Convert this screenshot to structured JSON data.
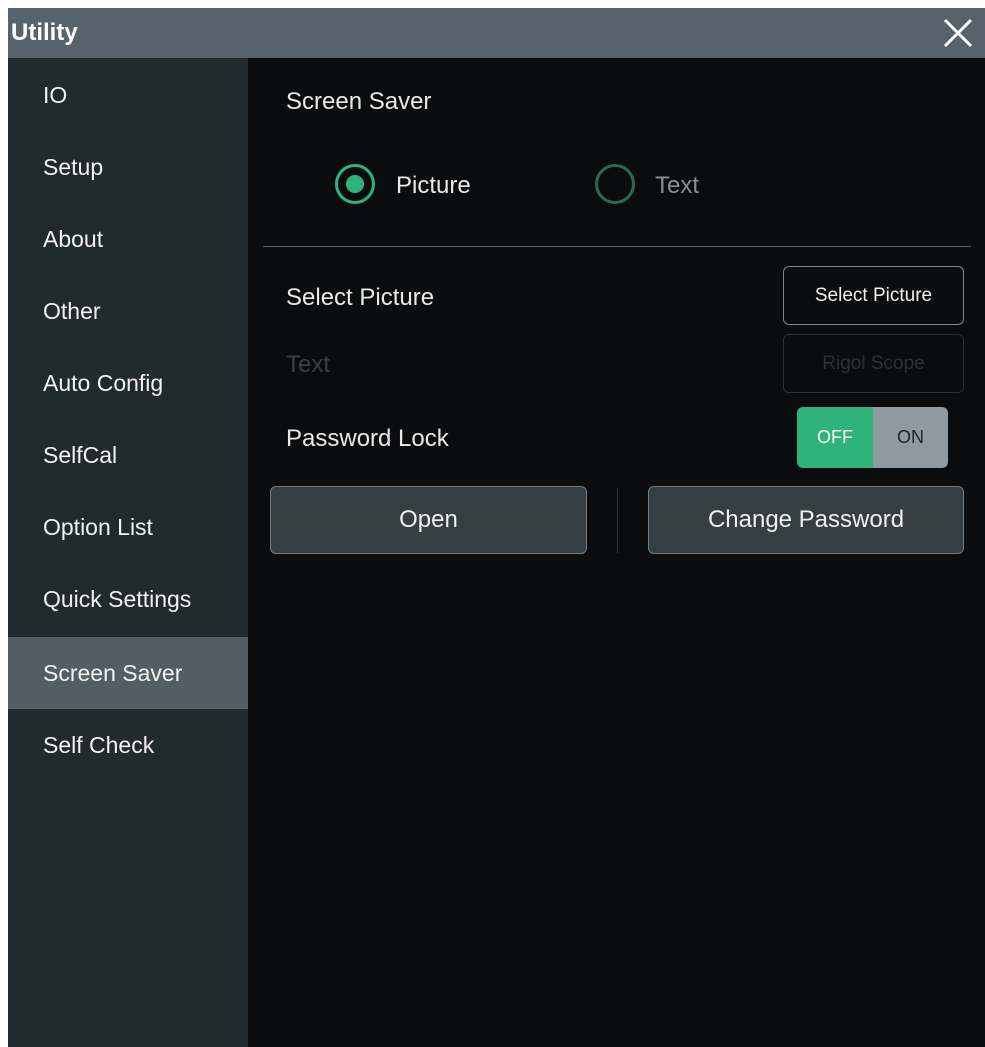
{
  "window": {
    "title": "Utility"
  },
  "sidebar": {
    "items": [
      {
        "label": "IO"
      },
      {
        "label": "Setup"
      },
      {
        "label": "About"
      },
      {
        "label": "Other"
      },
      {
        "label": "Auto Config"
      },
      {
        "label": "SelfCal"
      },
      {
        "label": "Option List"
      },
      {
        "label": "Quick Settings"
      },
      {
        "label": "Screen Saver",
        "active": true
      },
      {
        "label": "Self Check"
      }
    ]
  },
  "screen_saver": {
    "heading": "Screen Saver",
    "mode_options": [
      {
        "label": "Picture",
        "selected": true
      },
      {
        "label": "Text",
        "selected": false
      }
    ],
    "select_picture_label": "Select Picture",
    "select_picture_button": "Select Picture",
    "text_label": "Text",
    "text_value_button": "Rigol Scope",
    "password_lock_label": "Password Lock",
    "password_lock_toggle": {
      "off_label": "OFF",
      "on_label": "ON",
      "state": "OFF"
    },
    "open_button": "Open",
    "change_password_button": "Change Password"
  },
  "colors": {
    "accent": "#2fb37a",
    "titlebar": "#56636a",
    "sidebar": "#212a2d",
    "sidebar_active": "#525e63",
    "background": "#0b0c0d"
  },
  "icons": {
    "close": "close-icon"
  }
}
